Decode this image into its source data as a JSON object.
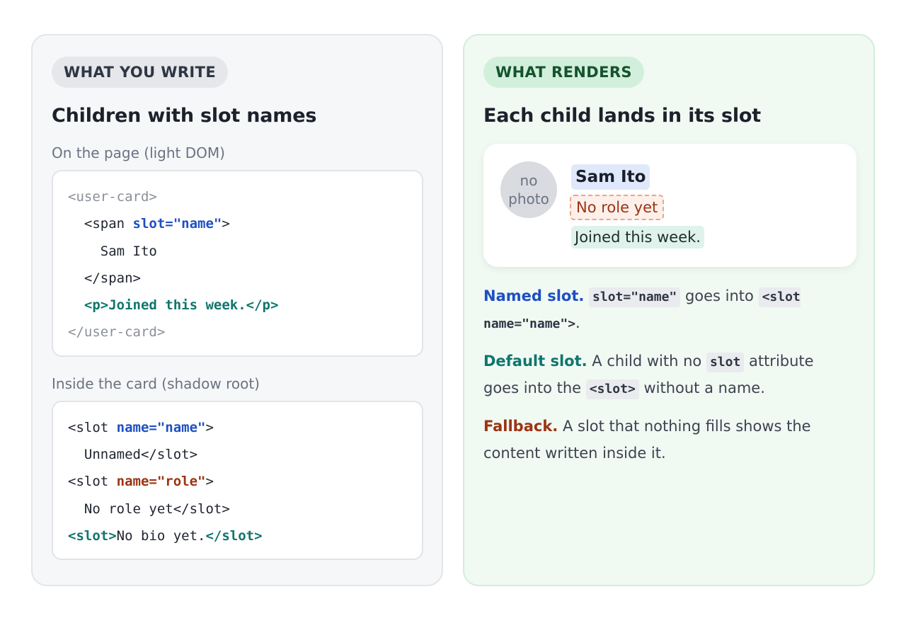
{
  "left": {
    "pill": "WHAT YOU WRITE",
    "heading": "Children with slot names",
    "light_label": "On the page (light DOM)",
    "light_code": {
      "open_tag": "<user-card>",
      "span_open_a": "  <span ",
      "span_attr": "slot=\"name\"",
      "span_open_b": ">",
      "text": "    Sam Ito",
      "span_close": "  </span>",
      "indent": "  ",
      "p_line": "<p>Joined this week.</p>",
      "close_tag": "</user-card>"
    },
    "shadow_label": "Inside the card (shadow root)",
    "shadow_code": {
      "slot_open": "<slot ",
      "name_attr": "name=\"name\"",
      "gt": ">",
      "name_fallback": "  Unnamed</slot>",
      "role_attr": "name=\"role\"",
      "role_fallback": "  No role yet</slot>",
      "default_open": "<slot>",
      "default_text": "No bio yet.",
      "default_close": "</slot>"
    }
  },
  "right": {
    "pill": "WHAT RENDERS",
    "heading": "Each child lands in its slot",
    "card": {
      "avatar_line1": "no",
      "avatar_line2": "photo",
      "name": "Sam Ito",
      "role": "No role yet",
      "bio": "Joined this week."
    },
    "notes": {
      "named_title": "Named slot.",
      "named_code1": "slot=\"name\"",
      "named_mid": " goes into ",
      "named_code2a": "<slot",
      "named_code2b": "name=\"name\">",
      "named_end": ".",
      "default_title": "Default slot.",
      "default_a": " A child with no ",
      "default_code1": "slot",
      "default_b": " attribute goes into the ",
      "default_code2": "<slot>",
      "default_c": " without a name.",
      "fallback_title": "Fallback.",
      "fallback_text": " A slot that nothing fills shows the content written inside it."
    }
  }
}
